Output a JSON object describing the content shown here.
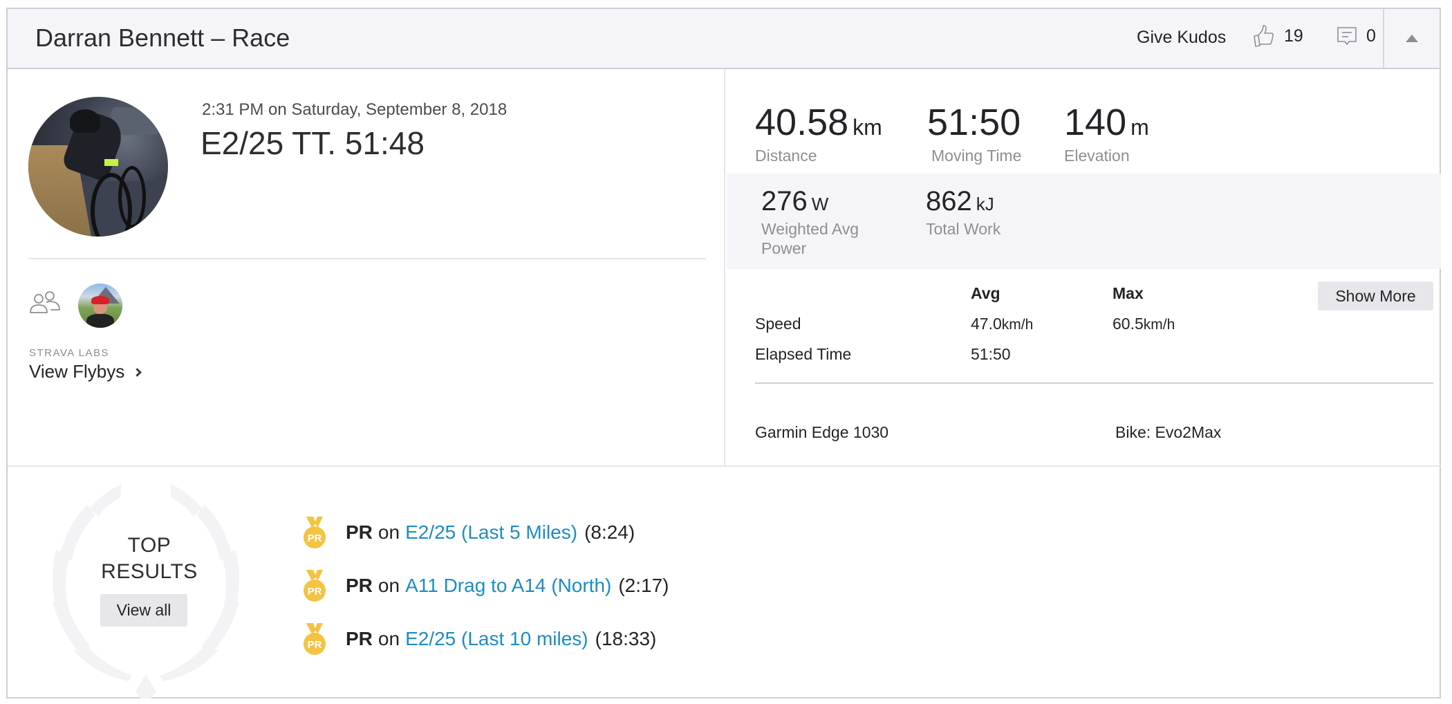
{
  "header": {
    "title": "Darran Bennett – Race",
    "give_kudos_label": "Give Kudos",
    "kudos_count": "19",
    "comment_count": "0",
    "icons": {
      "kudos": "thumbs-up-icon",
      "comment": "comment-icon",
      "collapse": "caret-up-icon"
    }
  },
  "activity": {
    "datetime": "2:31 PM on Saturday, September 8, 2018",
    "title": "E2/25 TT. 51:48",
    "labs_label": "STRAVA LABS",
    "flybys_label": "View Flybys"
  },
  "stats": {
    "primary": [
      {
        "value": "40.58",
        "unit": "km",
        "label": "Distance"
      },
      {
        "value": "51:50",
        "unit": "",
        "label": "Moving Time"
      },
      {
        "value": "140",
        "unit": "m",
        "label": "Elevation"
      }
    ],
    "secondary": [
      {
        "value": "276",
        "unit": "W",
        "label": "Weighted Avg Power"
      },
      {
        "value": "862",
        "unit": "kJ",
        "label": "Total Work"
      }
    ],
    "table": {
      "headers": {
        "avg": "Avg",
        "max": "Max"
      },
      "rows": [
        {
          "label": "Speed",
          "avg_value": "47.0",
          "avg_unit": "km/h",
          "max_value": "60.5",
          "max_unit": "km/h"
        },
        {
          "label": "Elapsed Time",
          "avg_value": "51:50",
          "avg_unit": "",
          "max_value": "",
          "max_unit": ""
        }
      ],
      "show_more_label": "Show More"
    },
    "device": "Garmin Edge 1030",
    "bike": "Bike: Evo2Max"
  },
  "top_results": {
    "label_line1": "TOP",
    "label_line2": "RESULTS",
    "view_all_label": "View all",
    "items": [
      {
        "badge": "PR",
        "on": "on",
        "segment": "E2/25 (Last 5 Miles)",
        "time": "(8:24)"
      },
      {
        "badge": "PR",
        "on": "on",
        "segment": "A11 Drag to A14 (North)",
        "time": "(2:17)"
      },
      {
        "badge": "PR",
        "on": "on",
        "segment": "E2/25 (Last 10 miles)",
        "time": "(18:33)"
      }
    ]
  },
  "colors": {
    "link": "#1c8cc5",
    "medal": "#f5c342",
    "header_bg": "#f5f5f9",
    "border": "#cfcfd4"
  }
}
